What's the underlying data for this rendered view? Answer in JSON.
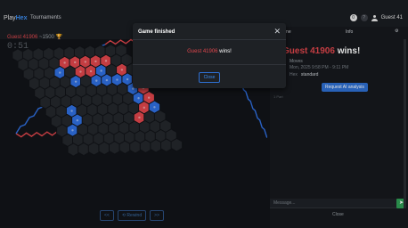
{
  "header": {
    "brand_left": "Play",
    "brand_accent": "Hex",
    "nav_tournaments": "Tournaments",
    "icon1": "0",
    "icon2": "?",
    "user": "Guest 41"
  },
  "player": {
    "name": "Guest 41906",
    "rating": "~1500",
    "trophy": "🏆",
    "timer": "0:51"
  },
  "controls": {
    "prev": "<<",
    "rewind": "⟲ Rewind",
    "next": ">>"
  },
  "side": {
    "tab_game": "Game",
    "tab_info": "Info",
    "winner_name": "Guest 41906",
    "winner_suffix": " wins!",
    "meta_line1": "Moves",
    "meta_line2": "Mon, 2025 9:58 PM - 9:11 PM",
    "meta_key": "Hex",
    "meta_value": "standard",
    "ai_button": "Request AI analysis",
    "small_note": "1 Part",
    "message_placeholder": "Message...",
    "send_icon": "➤",
    "close_label": "Close"
  },
  "modal": {
    "title": "Game finished",
    "winner_name": "Guest 41906",
    "winner_suffix": " wins!",
    "close_button": "Close"
  },
  "colors": {
    "red": "#e0464c",
    "blue": "#2f6fe0",
    "cell": "#24272c",
    "accent": "#3c8df0"
  }
}
